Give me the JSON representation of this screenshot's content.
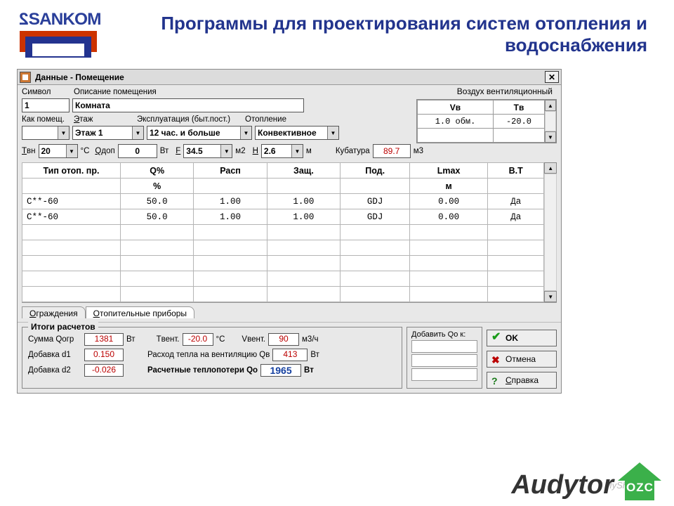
{
  "brand": {
    "logo": "SANKOM",
    "slogan": "Программы для проектирования систем отопления и водоснабжения",
    "product": "Audytor",
    "product_badge": "OZC",
    "watermark": "MyShared"
  },
  "window": {
    "title": "Данные - Помещение"
  },
  "labels": {
    "simvol": "Символ",
    "opisanie": "Описание помещения",
    "kak": "Как помещ.",
    "etazh": "Этаж",
    "ekspl": "Эксплуатация (быт.пост.)",
    "otopl": "Отопление",
    "tvn": "Tвн",
    "tvn_unit": "°C",
    "qdop": "Qдоп",
    "qdop_unit": "Вт",
    "f": "F",
    "f_unit": "м2",
    "h": "H",
    "h_unit": "м",
    "kub": "Кубатура",
    "kub_unit": "м3",
    "vent_title": "Воздух вентиляционный",
    "vent_h1": "Vв",
    "vent_h2": "Tв",
    "vent_v1": "1.0 обм.",
    "vent_v2": "-20.0"
  },
  "fields": {
    "simvol": "1",
    "opisanie": "Комната",
    "kak": "",
    "etazh": "Этаж 1",
    "ekspl": "12 час. и больше",
    "otopl": "Конвективное",
    "tvn": "20",
    "qdop": "0",
    "f": "34.5",
    "h": "2.6",
    "kub": "89.7"
  },
  "table": {
    "headers": [
      "Тип отоп. пр.",
      "Q%",
      "Расп",
      "Защ.",
      "Под.",
      "Lmax",
      "В.Т"
    ],
    "units": [
      "",
      "%",
      "",
      "",
      "",
      "м",
      ""
    ],
    "rows": [
      [
        "C**-60",
        "50.0",
        "1.00",
        "1.00",
        "GDJ",
        "0.00",
        "Да"
      ],
      [
        "C**-60",
        "50.0",
        "1.00",
        "1.00",
        "GDJ",
        "0.00",
        "Да"
      ]
    ],
    "blank_rows": 5
  },
  "tabs": {
    "t1": "Ограждения",
    "t2": "Отопительные приборы"
  },
  "results": {
    "title": "Итоги расчетов",
    "sum_qogr_l": "Сумма Qогр",
    "sum_qogr_v": "1381",
    "sum_qogr_u": "Вт",
    "tvent_l": "Tвент.",
    "tvent_v": "-20.0",
    "tvent_u": "°C",
    "vvent_l": "Vвент.",
    "vvent_v": "90",
    "vvent_u": "м3/ч",
    "d1_l": "Добавка d1",
    "d1_v": "0.150",
    "qv_l": "Расход тепла на вентиляцию Qв",
    "qv_v": "413",
    "qv_u": "Вт",
    "d2_l": "Добавка d2",
    "d2_v": "-0.026",
    "qo_l": "Расчетные теплопотери Qo",
    "qo_v": "1965",
    "qo_u": "Вт",
    "add_l": "Добавить Qо к:"
  },
  "buttons": {
    "ok": "OK",
    "cancel": "Отмена",
    "help": "Справка"
  }
}
